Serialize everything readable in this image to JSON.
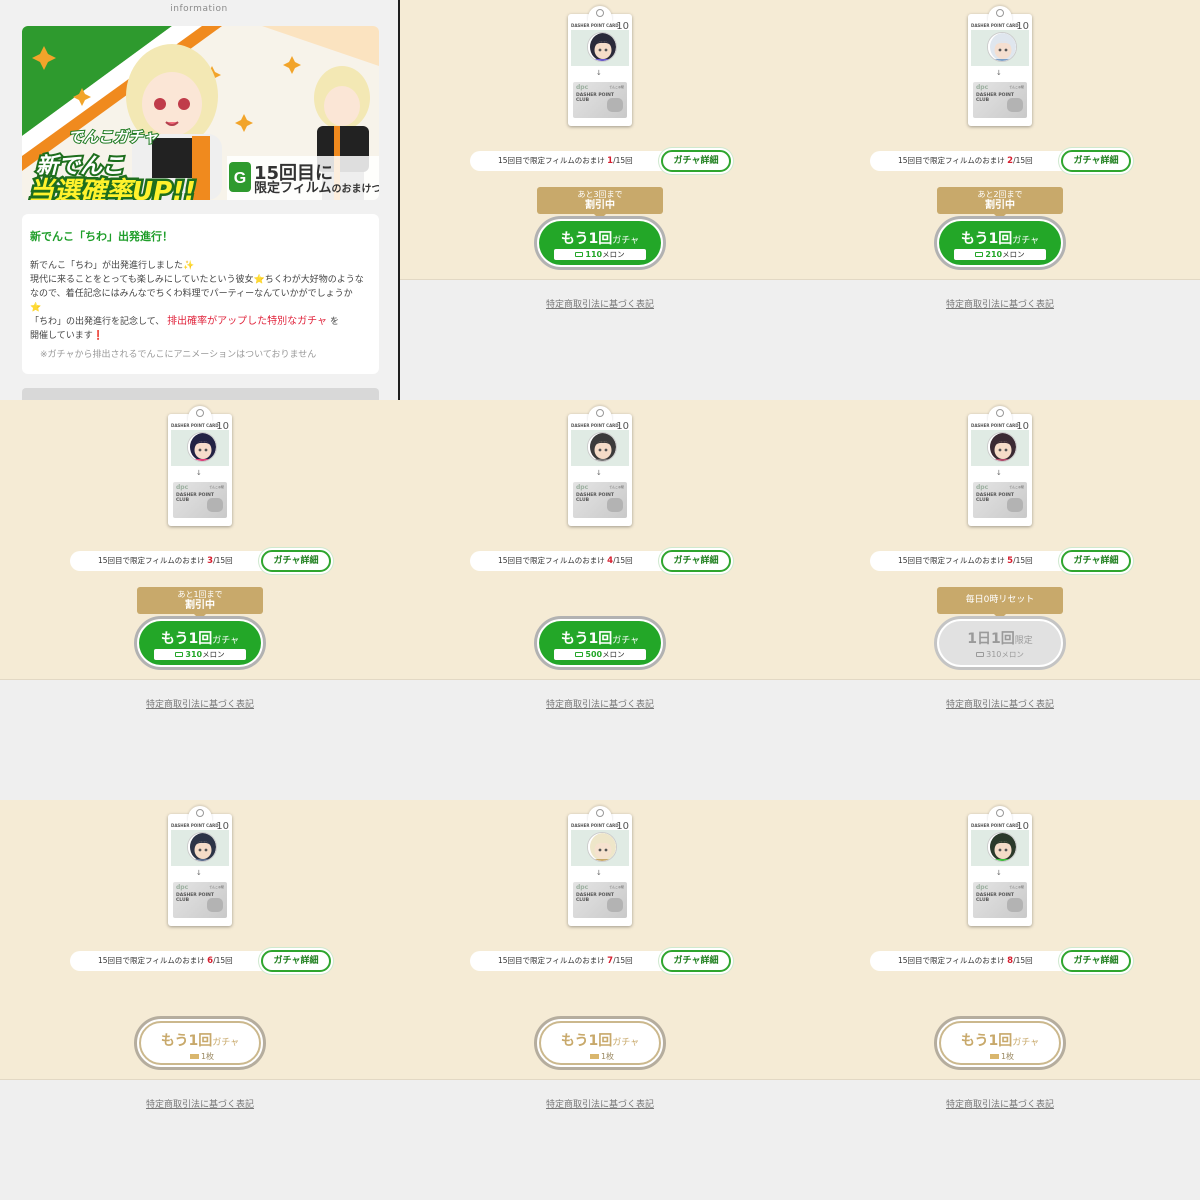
{
  "info": {
    "title": "information",
    "banner": {
      "label": "でんこガチャ",
      "title_line1": "新でんこ",
      "title_line2": "当選確率UP!!",
      "bonus_count": "15回目に",
      "bonus_text_main": "限定フィルム",
      "bonus_text_tail": "のおまけつき!"
    },
    "notice": {
      "heading": "新でんこ「ちわ」出発進行！",
      "line1": "新でんこ「ちわ」が出発進行しました✨",
      "line2": "現代に来ることをとっても楽しみにしていたという彼女⭐ちくわが大好物のような",
      "line3": "なので、着任記念にはみんなでちくわ料理でパーティーなんていかがでしょうか",
      "line4": "⭐",
      "line5_pre": "「ちわ」の出発進行を記念して、",
      "line5_highlight": "排出確率がアップした特別なガチャ",
      "line5_post": "を",
      "line6": "開催しています",
      "line6_mark": "❗",
      "note": "※ガチャから排出されるでんこにアニメーションはついておりません"
    }
  },
  "common": {
    "card_header": "DASHER POINT CARD",
    "card_number": "10",
    "card_arrow": "↓",
    "plate_brand": "dpc",
    "plate_sub": "でんこ@駅",
    "plate_text": "DASHER POINT CLUB",
    "progress_prefix": "15回目で限定フィルムのおまけ",
    "progress_suffix": "/15回",
    "details_label": "ガチャ詳細",
    "big_main": "もう1回",
    "big_sub": "ガチャ",
    "legal": "特定商取引法に基づく表記"
  },
  "gacha": [
    {
      "step": "1",
      "tag_small": "あと3回まで",
      "tag_big": "割引中",
      "price_num": "110",
      "price_unit": "メロン",
      "hair": "#2a2a3a",
      "skin": "#f5dcc8",
      "accent": "#6a5acd"
    },
    {
      "step": "2",
      "tag_small": "あと2回まで",
      "tag_big": "割引中",
      "price_num": "210",
      "price_unit": "メロン",
      "hair": "#dfe6ee",
      "skin": "#f5dfd0",
      "accent": "#7ea0c7"
    },
    {
      "step": "3",
      "tag_small": "あと1回まで",
      "tag_big": "割引中",
      "price_num": "310",
      "price_unit": "メロン",
      "hair": "#222244",
      "skin": "#f6dccb",
      "accent": "#e0407a"
    },
    {
      "step": "4",
      "price_num": "500",
      "price_unit": "メロン",
      "hair": "#3b3b3b",
      "skin": "#f5dcc8",
      "accent": "#777777"
    },
    {
      "step": "5",
      "tag_single": "毎日0時リセット",
      "limited_main": "1日1回",
      "limited_sub": "限定",
      "price_num": "310",
      "price_unit": "メロン",
      "hair": "#3a2a33",
      "skin": "#f5dcc8",
      "accent": "#b04a6a"
    },
    {
      "step": "6",
      "ticket_count": "1枚",
      "hair": "#2c3447",
      "skin": "#f5dcc8",
      "accent": "#5c6e8f"
    },
    {
      "step": "7",
      "ticket_count": "1枚",
      "hair": "#eee6c9",
      "skin": "#f6e2cf",
      "accent": "#c8a96b"
    },
    {
      "step": "8",
      "ticket_count": "1枚",
      "hair": "#2b3a2b",
      "skin": "#f5dcc8",
      "accent": "#3fbf3f"
    }
  ],
  "colors": {
    "green": "#23a728",
    "gold": "#c8a96b",
    "beige": "#f5ebd5",
    "red": "#d61f2f"
  }
}
